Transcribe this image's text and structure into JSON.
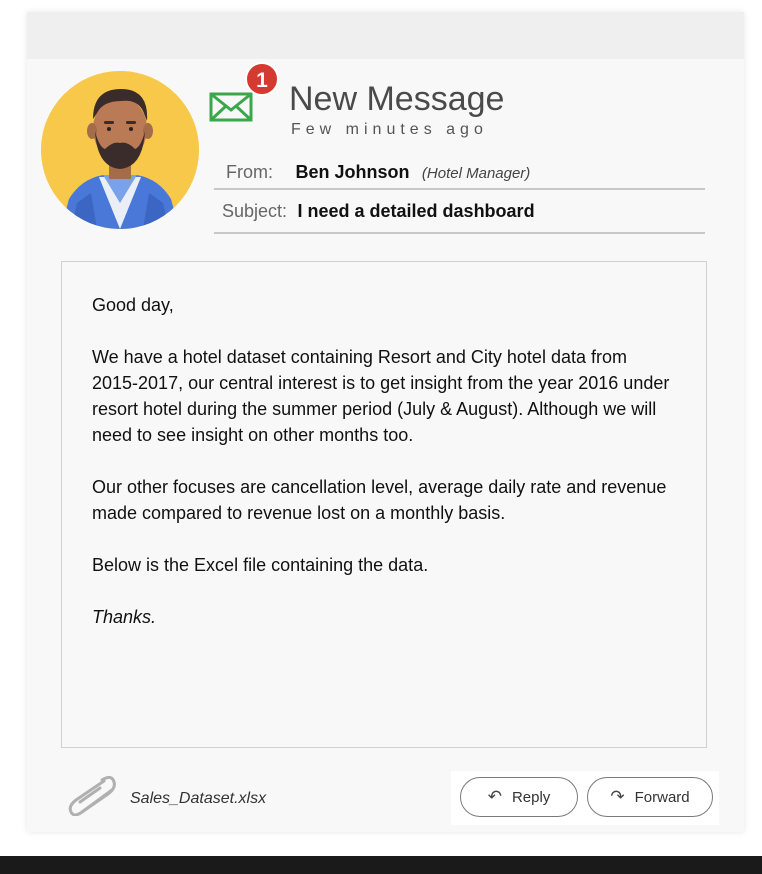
{
  "header": {
    "title": "New Message",
    "timestamp": "Few minutes ago",
    "notification_count": "1",
    "icon": "envelope-icon",
    "accent_color": "#3aa84a",
    "badge_color": "#d43a2f"
  },
  "meta": {
    "from_label": "From:",
    "sender_name": "Ben Johnson",
    "sender_role": "(Hotel Manager)",
    "subject_label": "Subject:",
    "subject": "I need a detailed dashboard"
  },
  "body": {
    "greeting": "Good day,",
    "paragraph1": "We have a hotel dataset containing Resort and City hotel data from 2015-2017, our central interest is to get insight from the year 2016 under resort hotel during the summer period (July & August). Although we will need to see insight on other months too.",
    "paragraph2": "Our other focuses are cancellation level, average daily rate and revenue made compared to revenue lost on a monthly basis.",
    "paragraph3": "Below is the Excel file containing the data.",
    "signoff": "Thanks."
  },
  "attachment": {
    "filename": "Sales_Dataset.xlsx",
    "icon": "paperclip-icon"
  },
  "actions": {
    "reply_label": "Reply",
    "reply_icon": "reply-arrow-icon",
    "forward_label": "Forward",
    "forward_icon": "forward-arrow-icon"
  }
}
